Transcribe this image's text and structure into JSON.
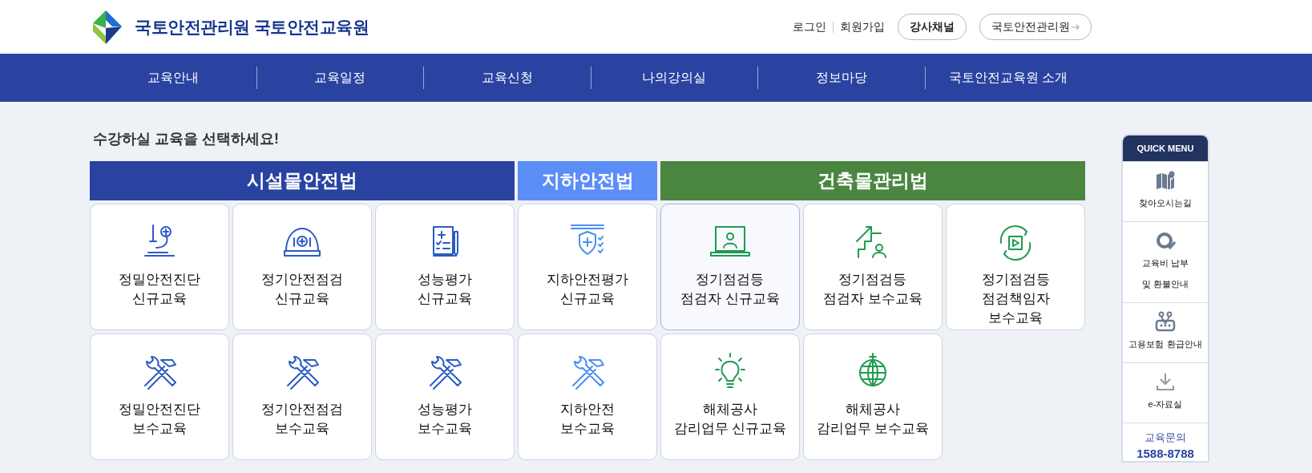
{
  "header": {
    "brand": "국토안전관리원 국토안전교육원",
    "links": [
      "로그인",
      "회원가입"
    ],
    "buttons": [
      "강사채널",
      "국토안전관리원"
    ]
  },
  "nav": [
    "교육안내",
    "교육일정",
    "교육신청",
    "나의강의실",
    "정보마당",
    "국토안전교육원 소개"
  ],
  "heading": "수강하실 교육을 선택하세요!",
  "sections": [
    {
      "title": "시설물안전법",
      "color": "#2a43a0",
      "rows": [
        [
          {
            "lines": [
              "정밀안전진단",
              "신규교육"
            ],
            "selected": false
          },
          {
            "lines": [
              "정기안전점검",
              "신규교육"
            ],
            "selected": false
          },
          {
            "lines": [
              "성능평가",
              "신규교육"
            ],
            "selected": false
          }
        ],
        [
          {
            "lines": [
              "정밀안전진단",
              "보수교육"
            ],
            "selected": false
          },
          {
            "lines": [
              "정기안전점검",
              "보수교육"
            ],
            "selected": false
          },
          {
            "lines": [
              "성능평가",
              "보수교육"
            ],
            "selected": false
          }
        ]
      ]
    },
    {
      "title": "지하안전법",
      "color": "#5b8ef7",
      "rows": [
        [
          {
            "lines": [
              "지하안전평가",
              "신규교육"
            ],
            "selected": false
          }
        ],
        [
          {
            "lines": [
              "지하안전",
              "보수교육"
            ],
            "selected": false
          }
        ]
      ]
    },
    {
      "title": "건축물관리법",
      "color": "#4a8640",
      "rows": [
        [
          {
            "lines": [
              "정기점검등",
              "점검자 신규교육"
            ],
            "selected": true
          },
          {
            "lines": [
              "정기점검등",
              "점검자 보수교육"
            ],
            "selected": false
          },
          {
            "lines": [
              "정기점검등",
              "점검책임자",
              "보수교육"
            ],
            "selected": false
          }
        ],
        [
          {
            "lines": [
              "해체공사",
              "감리업무 신규교육"
            ],
            "selected": false
          },
          {
            "lines": [
              "해체공사",
              "감리업무 보수교육"
            ],
            "selected": false
          }
        ]
      ]
    }
  ],
  "quick_menu": {
    "title": "QUICK MENU",
    "items": [
      {
        "lines": [
          "찾아오시는길"
        ]
      },
      {
        "lines": [
          "교육비 납부",
          "및 환불안내"
        ]
      },
      {
        "lines": [
          "고용보험 환급안내"
        ]
      },
      {
        "lines": [
          "e-자료실"
        ]
      }
    ],
    "contact": {
      "label": "교육문의",
      "phone": "1588-8788"
    }
  }
}
